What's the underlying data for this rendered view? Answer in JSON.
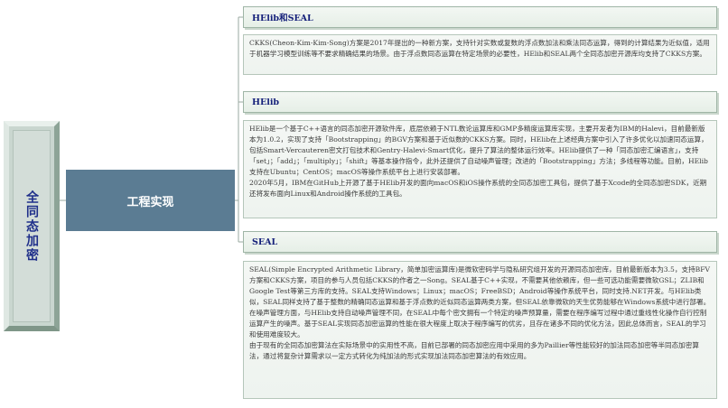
{
  "root": {
    "label": "全同态加密"
  },
  "branch": {
    "label": "工程实现"
  },
  "topics": [
    {
      "title": "HElib和SEAL",
      "paragraphs": [
        "CKKS(Cheon-Kim-Kim-Song)方案是2017年提出的一种新方案，支持针对实数或复数的浮点数加法和乘法同态运算，得到的计算结果为近似值，适用于机器学习模型训练等不要求精确结果的场景。由于浮点数同态运算在特定场景的必要性，HElib和SEAL两个全同态加密开源库均支持了CKKS方案。"
      ]
    },
    {
      "title": "HElib",
      "paragraphs": [
        "HElib是一个基于C++语言的同态加密开源软件库，底层依赖于NTL数论运算库和GMP多精度运算库实现，主要开发者为IBM的Halevi，目前最新版本为1.0.2，实现了支持「Bootstrapping」的BGV方案和基于近似数的CKKS方案。同时，HElib在上述经典方案中引入了许多优化以加速同态运算，包括Smart-Vercauteren密文打包技术和Gentry-Halevi-Smart优化，提升了算法的整体运行效率。HElib提供了一种「同态加密汇编语言」，支持「set」；「add」；「multiply」；「shift」等基本操作指令，此外还提供了自动噪声管理；改进的「Bootstrapping」方法；多线程等功能。目前，HElib支持在Ubuntu；CentOS；macOS等操作系统平台上进行安装部署。",
        "2020年5月，IBM在GitHub上开源了基于HElib开发的面向macOS和iOS操作系统的全同态加密工具包，提供了基于Xcode的全同态加密SDK，近期还将发布面向Linux和Android操作系统的工具包。"
      ]
    },
    {
      "title": "SEAL",
      "paragraphs": [
        "SEAL(Simple Encrypted Arithmetic Library，简单加密运算库)是微软密码学与隐私研究组开发的开源同态加密库，目前最新版本为3.5，支持BFV方案和CKKS方案，项目的参与人员包括CKKS的作者之一Song。SEAL基于C++实现，不需要其他依赖库，但一些可选功能需要微软GSL；ZLIB和Google Test等第三方库的支持。SEAL支持Windows；Linux；macOS；FreeBSD；Android等操作系统平台，同时支持.NET开发。与HElib类似，SEAL同样支持了基于整数的精确同态运算和基于浮点数的近似同态运算两类方案，但SEAL依靠微软的天生优势能够在Windows系统中进行部署。",
        "在噪声管理方面，与HElib支持自动噪声管理不同，在SEAL中每个密文拥有一个特定的噪声预算量，需要在程序编写过程中通过重线性化操作自行控制运算产生的噪声。基于SEAL实现同态加密运算的性能在很大程度上取决于程序编写的优劣，且存在诸多不同的优化方法，因此总体而言，SEAL的学习和使用难度较大。",
        "由于现有的全同态加密算法在实际场景中的实用性不高，目前已部署的同态加密应用中采用的多为Paillier等性能较好的加法同态加密等半同态加密算法，通过将复杂计算需求以一定方式转化为纯加法的形式实现加法同态加密算法的有效应用。"
      ]
    }
  ]
}
